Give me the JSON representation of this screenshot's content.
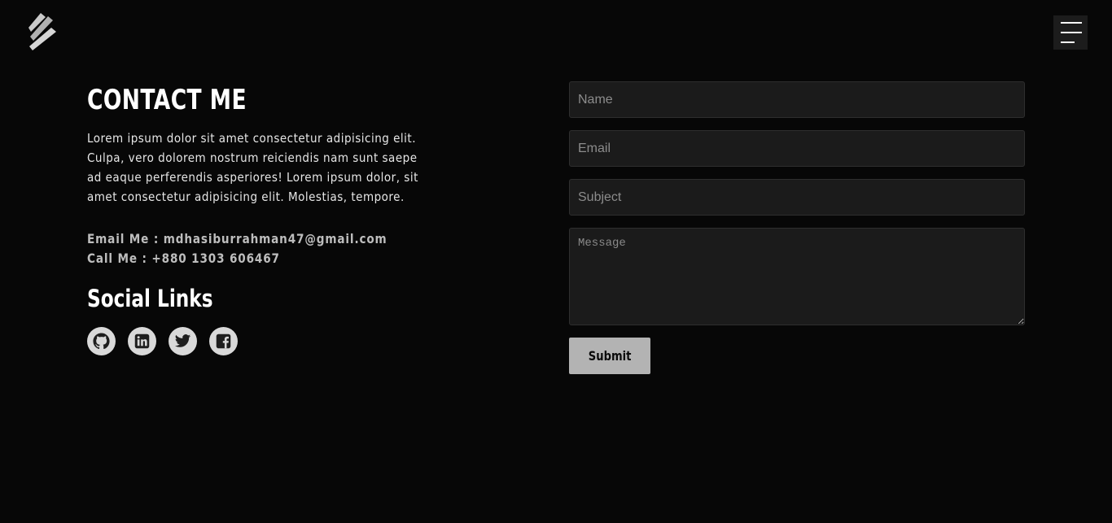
{
  "header": {
    "logo_icon": "diagonal-stripes-logo-icon",
    "menu_icon": "hamburger-menu-icon"
  },
  "contact": {
    "title": "CONTACT ME",
    "description": "Lorem ipsum dolor sit amet consectetur adipisicing elit. Culpa, vero dolorem nostrum reiciendis nam sunt saepe ad eaque perferendis asperiores! Lorem ipsum dolor, sit amet consectetur adipisicing elit. Molestias, tempore.",
    "email_line": "Email Me : mdhasiburrahman47@gmail.com",
    "phone_line": "Call Me : +880 1303 606467"
  },
  "social": {
    "title": "Social Links",
    "links": [
      {
        "icon": "github-icon"
      },
      {
        "icon": "linkedin-icon"
      },
      {
        "icon": "twitter-icon"
      },
      {
        "icon": "facebook-icon"
      }
    ]
  },
  "form": {
    "name_placeholder": "Name",
    "email_placeholder": "Email",
    "subject_placeholder": "Subject",
    "message_placeholder": "Message",
    "submit_label": "Submit"
  },
  "colors": {
    "background": "#070707",
    "input_background": "#1b1b1b",
    "button_background": "#b3b3b3",
    "social_icon_background": "#d9d9d9"
  }
}
